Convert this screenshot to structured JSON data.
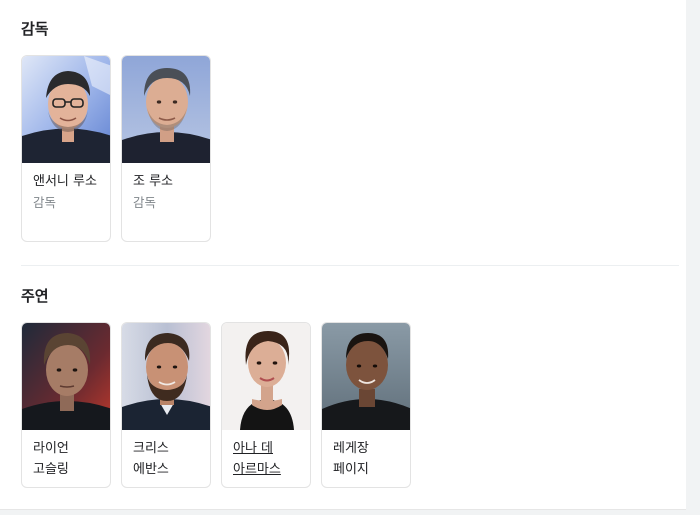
{
  "sections": {
    "directors": {
      "title": "감독",
      "people": [
        {
          "name": "앤서니 루소",
          "role": "감독"
        },
        {
          "name": "조 루소",
          "role": "감독"
        }
      ]
    },
    "cast": {
      "title": "주연",
      "people": [
        {
          "name": "라이언 고슬링"
        },
        {
          "name": "크리스 에반스"
        },
        {
          "name": "아나 데 아르마스"
        },
        {
          "name": "레게장 페이지"
        }
      ]
    }
  }
}
